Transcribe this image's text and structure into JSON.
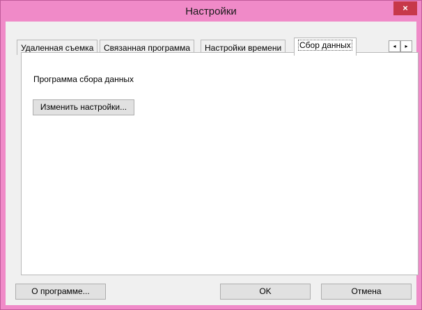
{
  "window": {
    "title": "Настройки",
    "close_glyph": "×"
  },
  "tabs": [
    {
      "label": "Удаленная съемка",
      "active": false
    },
    {
      "label": "Связанная программа",
      "active": false
    },
    {
      "label": "Настройки времени",
      "active": false
    },
    {
      "label": "Сбор данных",
      "active": true
    }
  ],
  "tab_scroll": {
    "left_glyph": "◂",
    "right_glyph": "▸"
  },
  "panel": {
    "section_label": "Программа сбора данных",
    "change_button": "Изменить настройки..."
  },
  "footer": {
    "about_button": "О программе...",
    "ok_button": "OK",
    "cancel_button": "Отмена"
  },
  "colors": {
    "title_bar": "#f08ac8",
    "close_button": "#c7384a",
    "dialog_bg": "#f0f0f0"
  }
}
